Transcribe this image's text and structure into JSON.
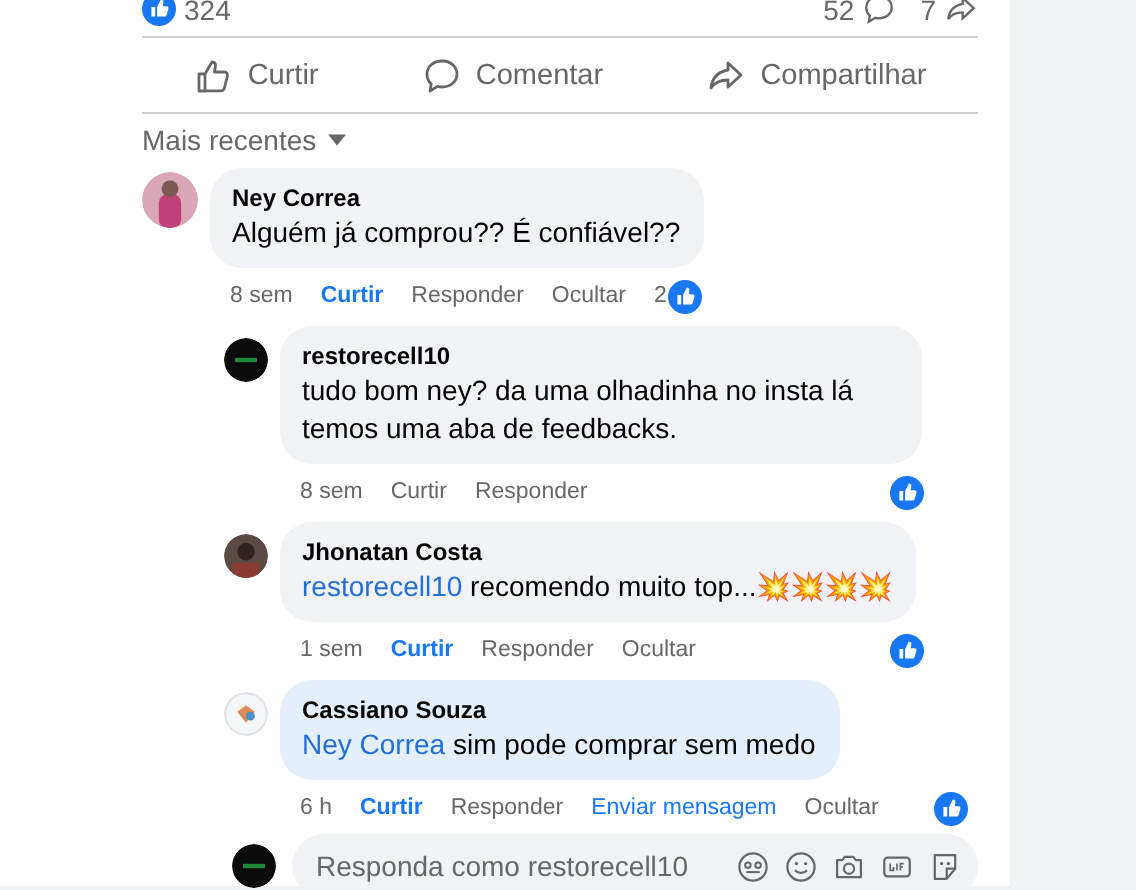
{
  "stats": {
    "likes": "324",
    "comments": "52",
    "shares": "7"
  },
  "actions": [
    {
      "kind": "like",
      "label": "Curtir"
    },
    {
      "kind": "comment",
      "label": "Comentar"
    },
    {
      "kind": "share",
      "label": "Compartilhar"
    }
  ],
  "sort": {
    "label": "Mais recentes"
  },
  "comments": [
    {
      "author": "Ney Correa",
      "text": "Alguém já comprou?? É confiável??",
      "time": "8 sem",
      "like_label": "Curtir",
      "liked": true,
      "highlighted": false,
      "links": [
        "Responder",
        "Ocultar"
      ],
      "reactions": "2",
      "replies": [
        {
          "author": "restorecell10",
          "text": "tudo bom ney? da uma olhadinha no insta lá temos uma aba de feedbacks.",
          "time": "8 sem",
          "like_label": "Curtir",
          "liked": false,
          "highlighted": false,
          "links": [
            "Responder"
          ]
        },
        {
          "author": "Jhonatan Costa",
          "mention": "restorecell10",
          "text": "recomendo muito top...💥💥💥💥",
          "time": "1 sem",
          "like_label": "Curtir",
          "liked": true,
          "highlighted": false,
          "links": [
            "Responder",
            "Ocultar"
          ]
        },
        {
          "author": "Cassiano Souza",
          "mention": "Ney Correa",
          "text": "sim pode comprar sem medo",
          "time": "6 h",
          "like_label": "Curtir",
          "liked": true,
          "highlighted": true,
          "links": [
            "Responder",
            "Enviar mensagem",
            "Ocultar"
          ]
        }
      ]
    }
  ],
  "composer": {
    "placeholder": "Responda como restorecell10"
  }
}
